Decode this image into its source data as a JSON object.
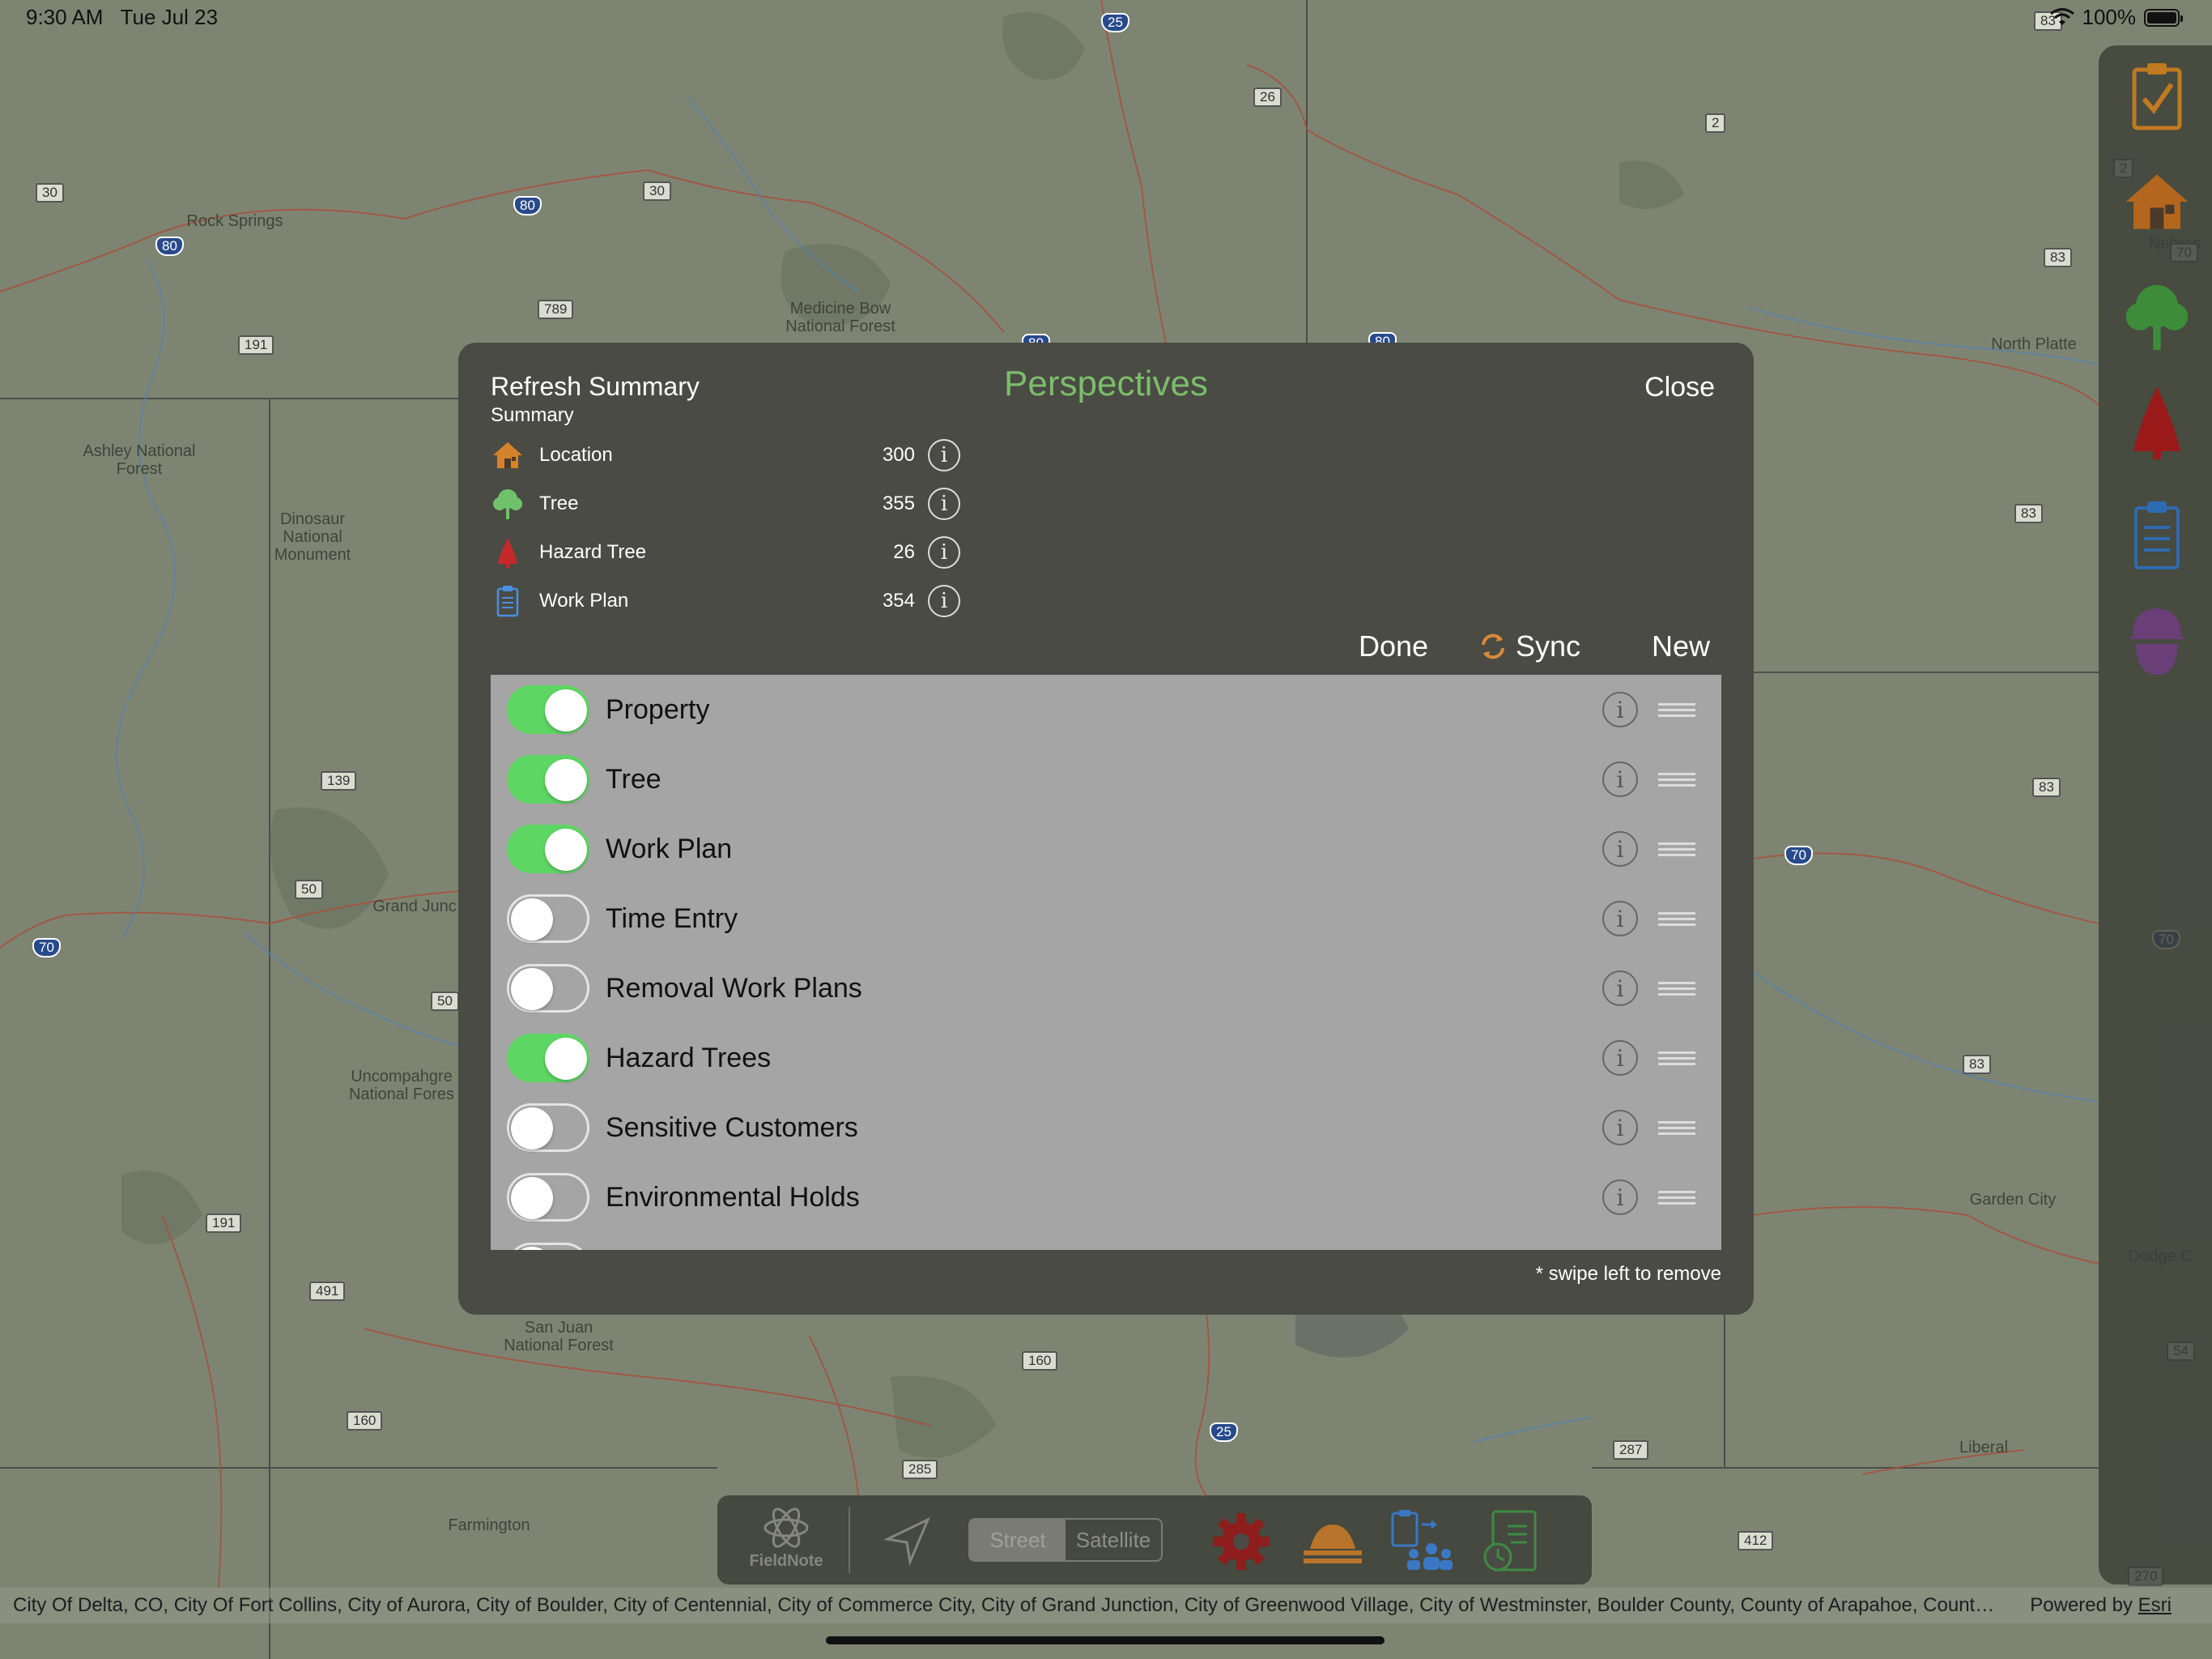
{
  "status_bar": {
    "time": "9:30 AM",
    "date": "Tue Jul 23",
    "battery": "100%"
  },
  "map": {
    "labels": [
      {
        "text": "Rock Springs"
      },
      {
        "text": "Ashley National\nForest"
      },
      {
        "text": "Dinosaur\nNational\nMonument"
      },
      {
        "text": "Medicine Bow\nNational Forest"
      },
      {
        "text": "North Platte"
      },
      {
        "text": "Nebras"
      },
      {
        "text": "Grand Junc"
      },
      {
        "text": "Uncompahgre\nNational Fores"
      },
      {
        "text": "San Juan\nNational Forest"
      },
      {
        "text": "Farmington"
      },
      {
        "text": "Garden City"
      },
      {
        "text": "Dodge C"
      },
      {
        "text": "Liberal"
      }
    ],
    "shields": [
      "30",
      "80",
      "80",
      "30",
      "789",
      "191",
      "25",
      "26",
      "2",
      "83",
      "83",
      "83",
      "83",
      "83",
      "139",
      "50",
      "50",
      "70",
      "70",
      "191",
      "491",
      "160",
      "285",
      "160",
      "287",
      "412",
      "25",
      "70",
      "54",
      "270",
      "80",
      "80",
      "2",
      "70"
    ]
  },
  "dialog": {
    "title": "Perspectives",
    "close_label": "Close",
    "summary_title": "Refresh Summary",
    "summary_subtitle": "Summary",
    "summary": [
      {
        "label": "Location",
        "count": "300",
        "icon": "house-icon"
      },
      {
        "label": "Tree",
        "count": "355",
        "icon": "tree-icon"
      },
      {
        "label": "Hazard Tree",
        "count": "26",
        "icon": "hazard-tree-icon"
      },
      {
        "label": "Work Plan",
        "count": "354",
        "icon": "clipboard-icon"
      }
    ],
    "done_label": "Done",
    "sync_label": "Sync",
    "new_label": "New",
    "perspectives": [
      {
        "name": "Property",
        "enabled": true
      },
      {
        "name": "Tree",
        "enabled": true
      },
      {
        "name": "Work Plan",
        "enabled": true
      },
      {
        "name": "Time Entry",
        "enabled": false
      },
      {
        "name": "Removal Work Plans",
        "enabled": false
      },
      {
        "name": "Hazard Trees",
        "enabled": true
      },
      {
        "name": "Sensitive Customers",
        "enabled": false
      },
      {
        "name": "Environmental Holds",
        "enabled": false
      }
    ],
    "hint": "* swipe left to remove",
    "info_glyph": "i"
  },
  "toolbar": {
    "logo_label": "FieldNote",
    "street_label": "Street",
    "satellite_label": "Satellite"
  },
  "attribution": {
    "text": "City Of Delta, CO, City Of Fort Collins, City of Aurora, City of Boulder, City of Centennial, City of Commerce City, City of Grand Junction, City of Greenwood Village, City of Westminster, Boulder County, County of Arapahoe, Count…",
    "powered_prefix": "Powered by ",
    "powered_brand": "Esri"
  },
  "colors": {
    "accent_green": "#7cbd6a",
    "toggle_on": "#5ed663",
    "dialog_bg": "#4a4b44",
    "list_bg": "#a5a5a5"
  }
}
